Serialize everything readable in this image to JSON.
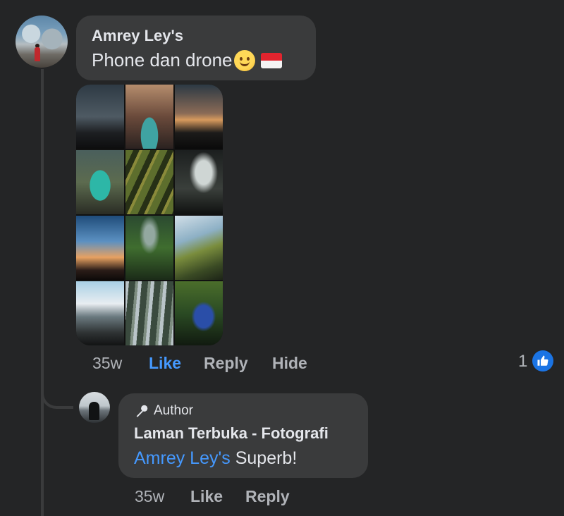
{
  "comment": {
    "author": "Amrey Ley's",
    "text": "Phone dan drone",
    "emojis": [
      "smiling-face-emoji",
      "indonesia-flag-emoji"
    ],
    "photo_count": 12,
    "time": "35w",
    "actions": {
      "like": "Like",
      "reply": "Reply",
      "hide": "Hide"
    },
    "reaction_count": "1",
    "reaction_type": "like",
    "colors": {
      "like_active": "#4599ff",
      "like_badge": "#1b74e4"
    }
  },
  "reply": {
    "badge": "Author",
    "author": "Laman Terbuka - Fotografi",
    "mention": "Amrey Ley's",
    "text": " Superb!",
    "time": "35w",
    "actions": {
      "like": "Like",
      "reply": "Reply"
    }
  },
  "theme": {
    "background": "#242526",
    "bubble": "#3a3b3c",
    "text": "#e4e6eb",
    "muted": "#b0b3b8"
  }
}
